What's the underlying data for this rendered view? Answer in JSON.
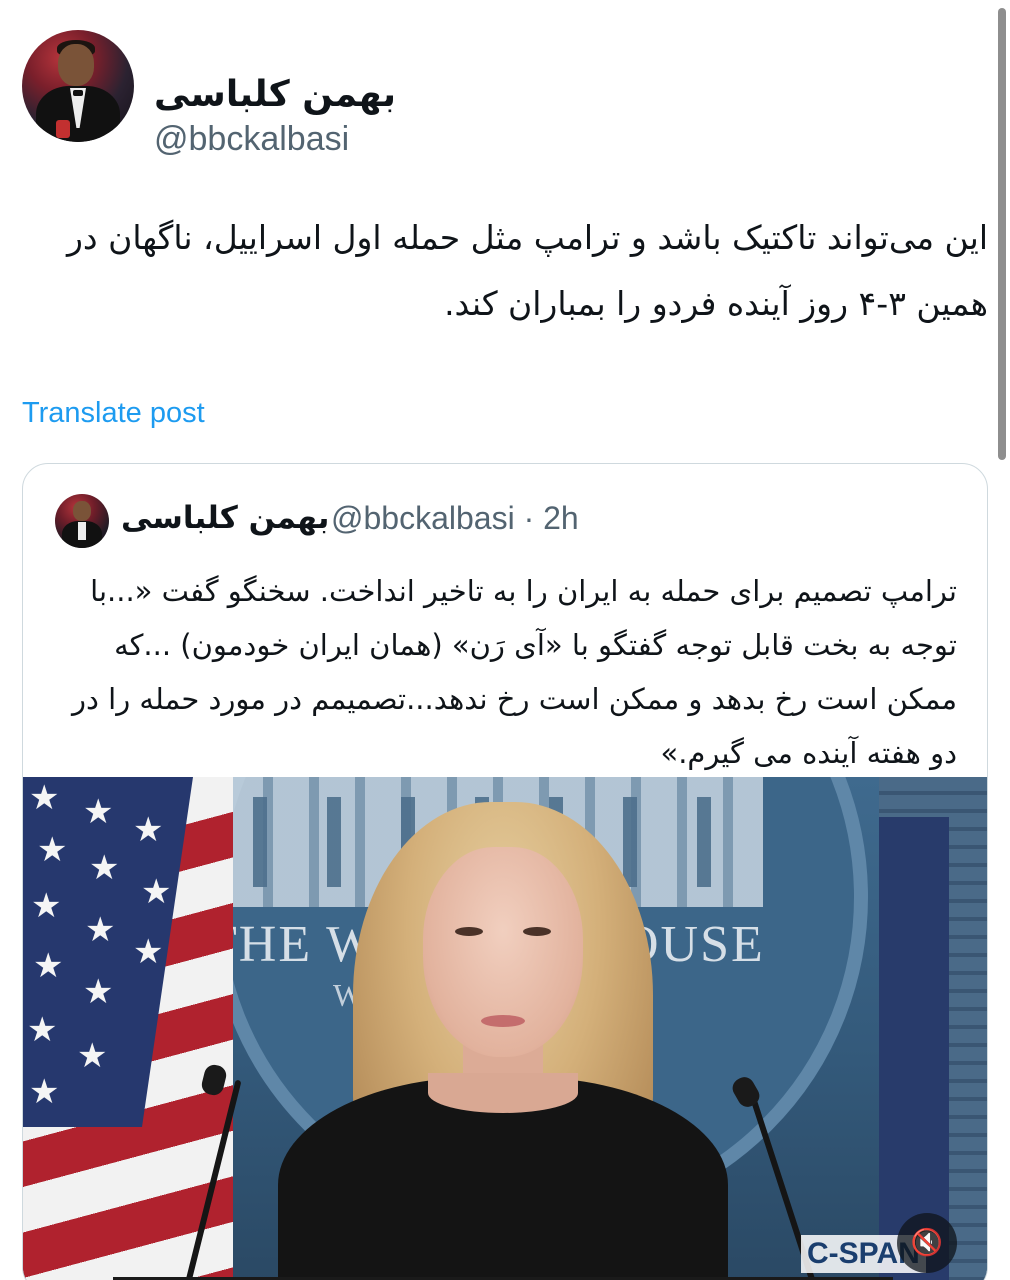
{
  "post": {
    "author_name": "بهمن کلباسی",
    "author_handle": "@bbckalbasi",
    "text": "این می‌تواند تاکتیک باشد و ترامپ مثل حمله اول اسراییل، ناگهان در همین ۳-۴ روز آینده فردو را بمباران کند.",
    "translate_label": "Translate post"
  },
  "quoted_post": {
    "author_name": "بهمن کلباسی",
    "meta": "@bbckalbasi · 2h",
    "text": "ترامپ تصمیم برای حمله به ایران را به تاخیر انداخت. سخنگو گفت «...با توجه به بخت قابل توجه  گفتگو  با «آی رَن» (همان ایران خودمون) ...که ممکن است رخ بدهد و ممکن است رخ ندهد...تصمیمم در مورد حمله را در دو هفته آینده می گیرم.»",
    "media": {
      "backdrop_text": "THE W",
      "backdrop_text_right": "OUSE",
      "backdrop_sub": "W",
      "watermark": "C-SPAN",
      "mute_icon": "🔇"
    }
  },
  "icons": {
    "mute": "speaker-muted-icon"
  }
}
